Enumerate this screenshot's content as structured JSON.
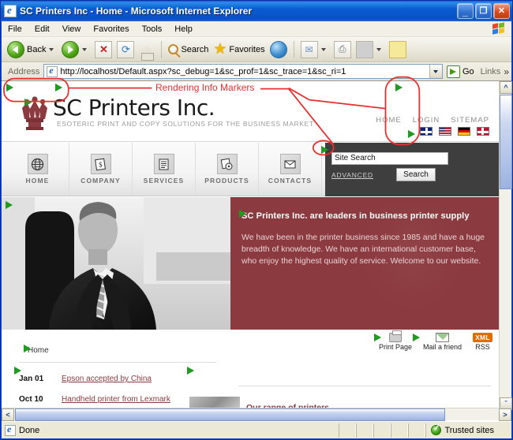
{
  "window": {
    "title": "SC Printers Inc - Home - Microsoft Internet Explorer",
    "minimize_label": "_",
    "restore_label": "❐",
    "close_label": "✕"
  },
  "menubar": {
    "items": [
      "File",
      "Edit",
      "View",
      "Favorites",
      "Tools",
      "Help"
    ]
  },
  "toolbar": {
    "back_label": "Back",
    "search_label": "Search",
    "favorites_label": "Favorites"
  },
  "addressbar": {
    "label": "Address",
    "url": "http://localhost/Default.aspx?sc_debug=1&sc_prof=1&sc_trace=1&sc_ri=1",
    "go_label": "Go",
    "links_label": "Links",
    "chevron": "»"
  },
  "site": {
    "brand": "SC Printers Inc.",
    "tagline": "ESOTERIC PRINT AND COPY SOLUTIONS FOR THE BUSINESS MARKET",
    "header_links": [
      "HOME",
      "LOGIN",
      "SITEMAP"
    ],
    "flags": [
      "uk-flag",
      "us-flag",
      "germany-flag",
      "denmark-flag"
    ],
    "nav": [
      {
        "label": "HOME",
        "icon": "globe-icon",
        "glyph": "🌐"
      },
      {
        "label": "COMPANY",
        "icon": "money-document-icon",
        "glyph": "💲"
      },
      {
        "label": "SERVICES",
        "icon": "document-lines-icon",
        "glyph": "▤"
      },
      {
        "label": "PRODUCTS",
        "icon": "cd-disc-icon",
        "glyph": "◍"
      },
      {
        "label": "CONTACTS",
        "icon": "envelope-icon",
        "glyph": "✉"
      }
    ],
    "search": {
      "value": "Site Search",
      "placeholder": "Site Search",
      "advanced_label": "ADVANCED",
      "button_label": "Search"
    },
    "intro": {
      "heading": "SC Printers Inc. are leaders in business printer supply",
      "body": "We have been in the printer business since 1985 and have a huge breadth of knowledge. We have an international customer base, who enjoy the highest quality of service. Welcome to our website."
    },
    "actions": [
      {
        "label": "Print Page",
        "icon": "printer-icon"
      },
      {
        "label": "Mail a friend",
        "icon": "mail-icon"
      },
      {
        "label": "RSS",
        "icon": "xml-badge-icon",
        "badge": "XML"
      }
    ],
    "breadcrumb": "Home",
    "news": [
      {
        "date": "Jan 01",
        "title": "Epson accepted by China"
      },
      {
        "date": "Oct 10",
        "title": "Handheld printer from Lexmark"
      }
    ],
    "range_heading": "Our range of printers"
  },
  "annotation": {
    "label": "Rendering Info Markers",
    "color": "#e83030"
  },
  "statusbar": {
    "text": "Done",
    "zone": "Trusted sites"
  },
  "colors": {
    "accent_red": "#8b3a3f",
    "marker_green": "#1f9c1f",
    "titlebar_blue": "#0a5bd0",
    "nav_dark": "#3e3e3e"
  }
}
